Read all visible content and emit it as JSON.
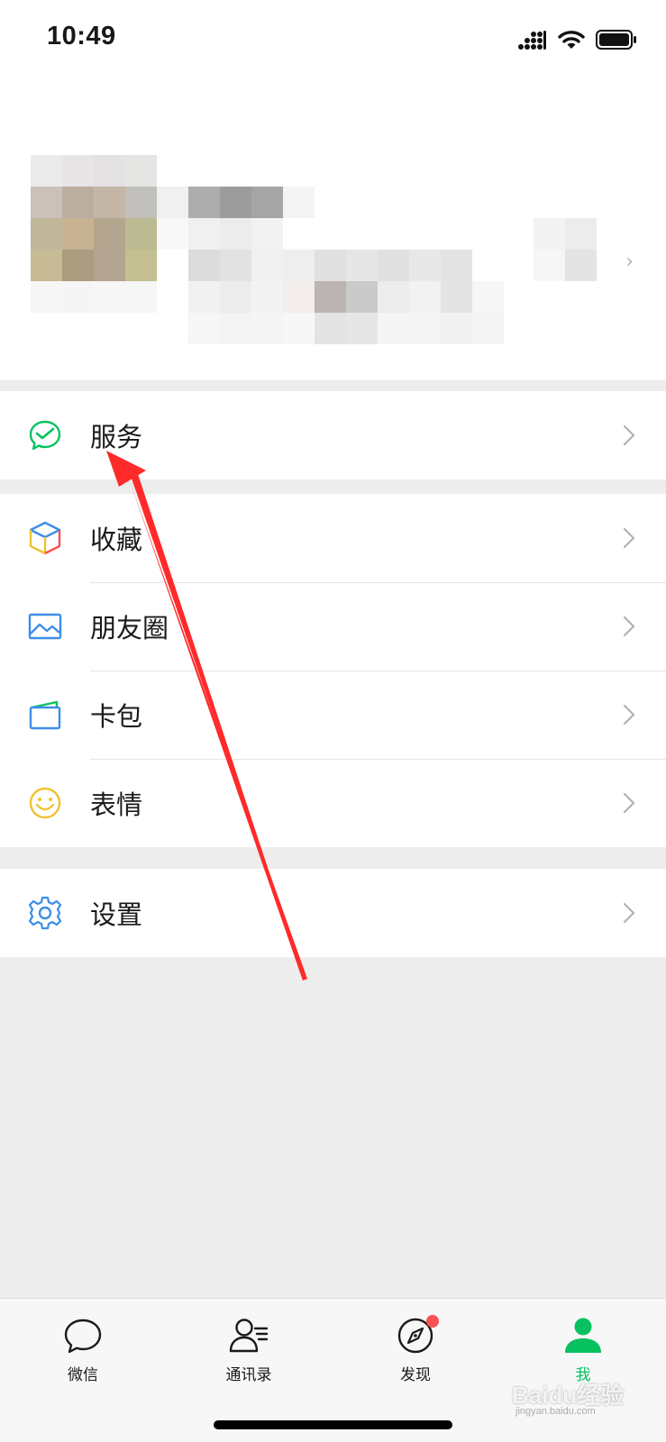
{
  "status_bar": {
    "time": "10:49"
  },
  "profile": {
    "chevron": "›"
  },
  "menu_groups": [
    {
      "items": [
        {
          "label": "服务",
          "icon": "service-icon",
          "color": "#07c160"
        }
      ]
    },
    {
      "items": [
        {
          "label": "收藏",
          "icon": "favorites-cube-icon",
          "color": "#fa9d3b"
        },
        {
          "label": "朋友圈",
          "icon": "moments-picture-icon",
          "color": "#3c8ee8"
        },
        {
          "label": "卡包",
          "icon": "card-wallet-icon",
          "color": "#3c8ee8"
        },
        {
          "label": "表情",
          "icon": "sticker-smiley-icon",
          "color": "#f0c230"
        }
      ]
    },
    {
      "items": [
        {
          "label": "设置",
          "icon": "settings-gear-icon",
          "color": "#3c8ee8"
        }
      ]
    }
  ],
  "tabbar": {
    "tabs": [
      {
        "label": "微信",
        "icon": "chat-bubble-icon",
        "active": false
      },
      {
        "label": "通讯录",
        "icon": "contacts-icon",
        "active": false
      },
      {
        "label": "发现",
        "icon": "discover-compass-icon",
        "active": false,
        "badge": "dot"
      },
      {
        "label": "我",
        "icon": "me-person-icon",
        "active": true
      }
    ]
  },
  "watermark": {
    "brand": "Baidu经验",
    "url": "jingyan.baidu.com"
  },
  "colors": {
    "accent": "#07c160",
    "badge": "#fa5151",
    "annotation": "#ff2a2a"
  }
}
